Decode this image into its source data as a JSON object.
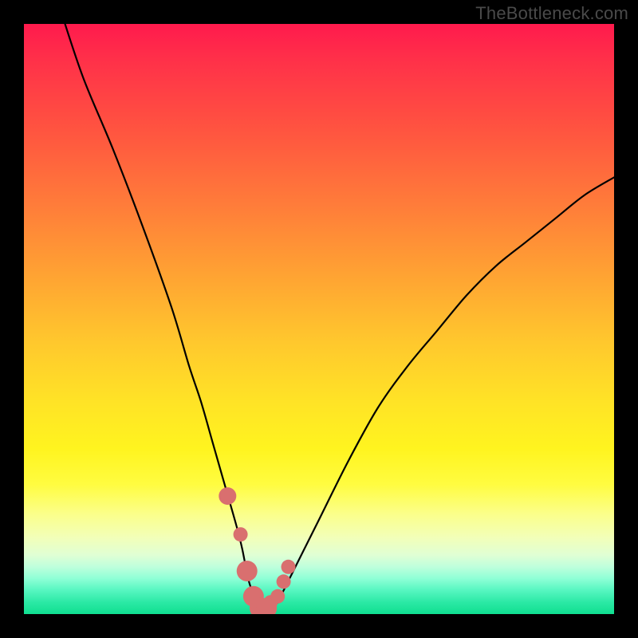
{
  "watermark": "TheBottleneck.com",
  "chart_data": {
    "type": "line",
    "title": "",
    "xlabel": "",
    "ylabel": "",
    "ylim": [
      0,
      100
    ],
    "xlim": [
      0,
      100
    ],
    "series": [
      {
        "name": "bottleneck-curve",
        "x": [
          6,
          10,
          15,
          20,
          25,
          28,
          30,
          32,
          34,
          36,
          37,
          38,
          39,
          40,
          41,
          42,
          43,
          44,
          46,
          50,
          55,
          60,
          65,
          70,
          75,
          80,
          85,
          90,
          95,
          100
        ],
        "values": [
          103,
          91,
          79,
          66,
          52,
          42,
          36,
          29,
          22,
          15,
          11,
          6,
          3,
          1,
          1,
          1,
          2,
          4,
          8,
          16,
          26,
          35,
          42,
          48,
          54,
          59,
          63,
          67,
          71,
          74
        ]
      }
    ],
    "markers": {
      "name": "highlight-points",
      "color": "#d96f6f",
      "x": [
        34.5,
        40.5,
        36.7,
        41.8,
        43.0,
        37.8,
        38.9,
        40.0,
        41.1,
        44.0,
        44.8
      ],
      "y": [
        20.0,
        1.0,
        13.5,
        2.0,
        3.0,
        7.3,
        3.0,
        1.0,
        1.0,
        5.5,
        8.0
      ],
      "r": [
        11,
        11,
        9,
        9,
        9,
        13,
        13,
        13,
        13,
        9,
        9
      ]
    },
    "gradient_stops": [
      {
        "pct": 0,
        "color": "#ff1a4d"
      },
      {
        "pct": 18,
        "color": "#ff5440"
      },
      {
        "pct": 42,
        "color": "#ffa133"
      },
      {
        "pct": 64,
        "color": "#ffe326"
      },
      {
        "pct": 83,
        "color": "#fbff8a"
      },
      {
        "pct": 92,
        "color": "#beffdc"
      },
      {
        "pct": 100,
        "color": "#10df90"
      }
    ]
  }
}
